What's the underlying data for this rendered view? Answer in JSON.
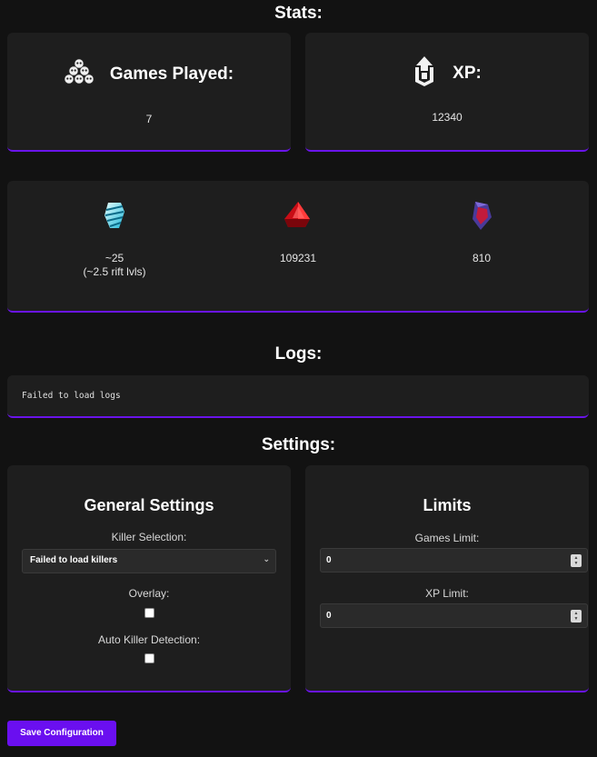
{
  "stats": {
    "title": "Stats:",
    "games_played": {
      "label": "Games Played:",
      "value": "7",
      "icon": "skull-pile-icon"
    },
    "xp": {
      "label": "XP:",
      "value": "12340",
      "icon": "xp-upgrade-icon"
    },
    "currencies": [
      {
        "icon": "rift-fragment-icon",
        "value_line1": "~25",
        "value_line2": "(~2.5 rift lvls)"
      },
      {
        "icon": "bloodpoints-gem-icon",
        "value_line1": "109231"
      },
      {
        "icon": "iridescent-shards-icon",
        "value_line1": "810"
      }
    ]
  },
  "logs": {
    "title": "Logs:",
    "text": "Failed to load logs"
  },
  "settings": {
    "title": "Settings:",
    "general": {
      "title": "General Settings",
      "killer_label": "Killer Selection:",
      "killer_selected": "Failed to load killers",
      "overlay_label": "Overlay:",
      "auto_label": "Auto Killer Detection:"
    },
    "limits": {
      "title": "Limits",
      "games_label": "Games Limit:",
      "games_value": "0",
      "xp_label": "XP Limit:",
      "xp_value": "0"
    }
  },
  "save_button": "Save Configuration",
  "colors": {
    "accent": "#6a14ea",
    "card_bg": "#1e1e1e",
    "page_bg": "#121212"
  }
}
